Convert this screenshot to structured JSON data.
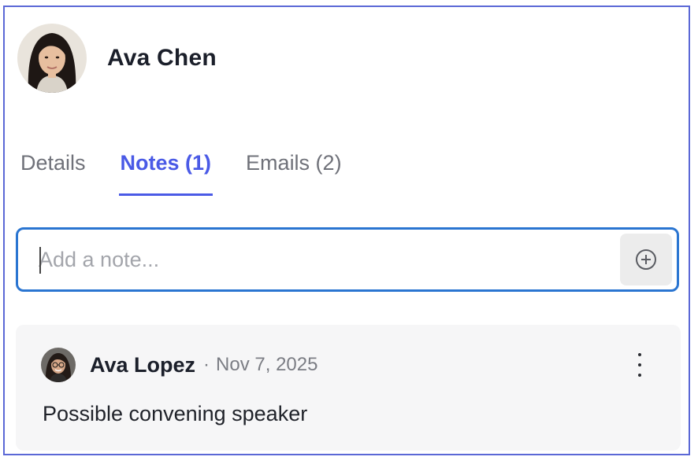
{
  "contact": {
    "name": "Ava Chen",
    "avatar": "portrait-woman-icon"
  },
  "tabs": [
    {
      "label": "Details",
      "active": false
    },
    {
      "label": "Notes (1)",
      "active": true
    },
    {
      "label": "Emails (2)",
      "active": false
    }
  ],
  "note_input": {
    "placeholder": "Add a note...",
    "value": "",
    "add_icon": "plus-circle-icon"
  },
  "notes": [
    {
      "author": "Ava Lopez",
      "separator": "·",
      "date": "Nov 7, 2025",
      "body": "Possible convening speaker",
      "menu_icon": "more-vertical-icon"
    }
  ],
  "colors": {
    "frame_border": "#5b68d6",
    "accent": "#4a5ae6",
    "input_focus": "#2a75d1",
    "card_bg": "#f6f6f7"
  }
}
